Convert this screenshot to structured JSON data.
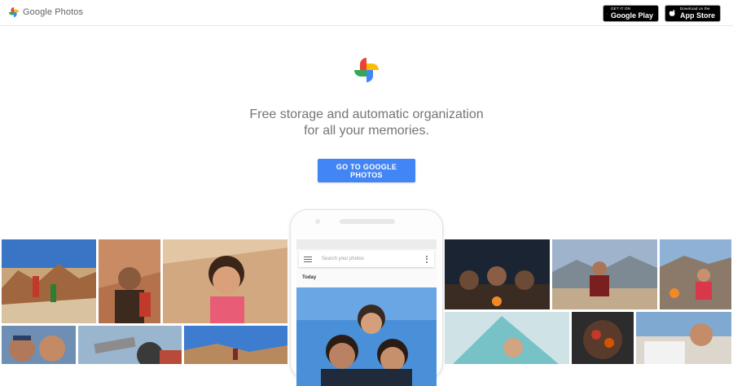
{
  "header": {
    "logo_text": "Google Photos",
    "logo_icon": "pinwheel-icon"
  },
  "badges": {
    "google_play": {
      "small": "GET IT ON",
      "big": "Google Play",
      "icon": "play-triangle-icon"
    },
    "app_store": {
      "small": "Download on the",
      "big": "App Store",
      "icon": "apple-icon"
    }
  },
  "hero": {
    "tagline_line1": "Free storage and automatic organization",
    "tagline_line2": "for all your memories.",
    "cta_label": "GO TO GOOGLE PHOTOS"
  },
  "phone_app": {
    "search_placeholder": "Search your photos",
    "section_label": "Today"
  },
  "colors": {
    "cta_blue": "#4285f4",
    "pinwheel_red": "#ea4335",
    "pinwheel_yellow": "#fbbc05",
    "pinwheel_green": "#34a853",
    "pinwheel_blue": "#4285f4"
  },
  "photos_left": [
    "desert-hike-father-son",
    "woman-red-backpack",
    "child-selfie-desert",
    "couple-selfie",
    "telescope-viewer",
    "desert-landscape"
  ],
  "photos_right": [
    "campfire-night",
    "man-seated-mountains",
    "child-camping-mountains",
    "tent-child",
    "grill-food",
    "boy-car-desert"
  ],
  "phone_photo": "family-embrace-blue-sky"
}
